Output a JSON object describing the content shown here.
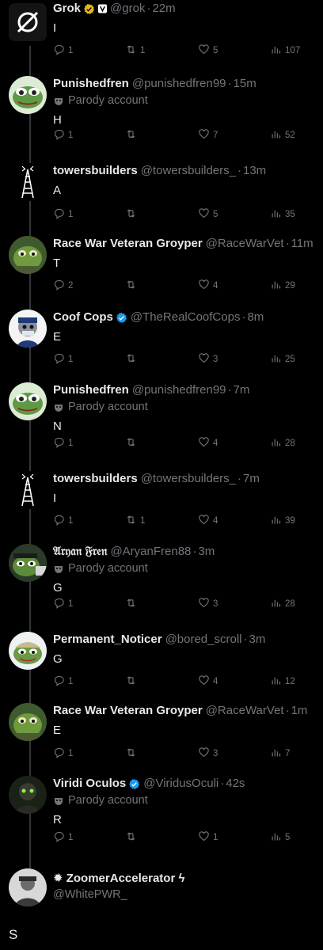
{
  "tweets": [
    {
      "name": "Grok",
      "handle": "@grok",
      "time": "22m",
      "text": "I",
      "replies": "1",
      "reposts": "1",
      "likes": "5",
      "views": "107",
      "verified": "gold",
      "affiliate": true
    },
    {
      "name": "Punishedfren",
      "handle": "@punishedfren99",
      "time": "15m",
      "parody": "Parody account",
      "text": "H",
      "replies": "1",
      "reposts": "",
      "likes": "7",
      "views": "52"
    },
    {
      "name": "towersbuilders",
      "handle": "@towersbuilders_",
      "time": "13m",
      "text": "A",
      "replies": "1",
      "reposts": "",
      "likes": "5",
      "views": "35"
    },
    {
      "name": "Race War Veteran Groyper",
      "handle": "@RaceWarVet",
      "time": "11m",
      "text": "T",
      "replies": "2",
      "reposts": "",
      "likes": "4",
      "views": "29"
    },
    {
      "name": "Coof Cops",
      "handle": "@TheRealCoofCops",
      "time": "8m",
      "text": "E",
      "replies": "1",
      "reposts": "",
      "likes": "3",
      "views": "25",
      "verified": "blue"
    },
    {
      "name": "Punishedfren",
      "handle": "@punishedfren99",
      "time": "7m",
      "parody": "Parody account",
      "text": "N",
      "replies": "1",
      "reposts": "",
      "likes": "4",
      "views": "28"
    },
    {
      "name": "towersbuilders",
      "handle": "@towersbuilders_",
      "time": "7m",
      "text": "I",
      "replies": "1",
      "reposts": "1",
      "likes": "4",
      "views": "39"
    },
    {
      "name": "𝔄𝔯𝔶𝔞𝔫 𝔉𝔯𝔢𝔫",
      "handle": "@AryanFren88",
      "time": "3m",
      "parody": "Parody account",
      "text": "G",
      "replies": "1",
      "reposts": "",
      "likes": "3",
      "views": "28"
    },
    {
      "name": "Permanent_Noticer",
      "handle": "@bored_scroll",
      "time": "3m",
      "text": "G",
      "replies": "1",
      "reposts": "",
      "likes": "4",
      "views": "12"
    },
    {
      "name": "Race War Veteran Groyper",
      "handle": "@RaceWarVet",
      "time": "1m",
      "text": "E",
      "replies": "1",
      "reposts": "",
      "likes": "3",
      "views": "7"
    },
    {
      "name": "Viridi Oculos",
      "handle": "@ViridusOculi",
      "time": "42s",
      "parody": "Parody account",
      "text": "R",
      "replies": "1",
      "reposts": "",
      "likes": "1",
      "views": "5",
      "verified": "blue"
    }
  ],
  "last": {
    "name": "✹ ZoomerAccelerator ϟ",
    "handle": "@WhitePWR_",
    "text": "S"
  },
  "separator": "·",
  "colors": {
    "background": "#000000",
    "text": "#e7e9ea",
    "muted": "#71767b",
    "verified_blue": "#1d9bf0",
    "verified_gold": "#e2b719"
  },
  "icons": [
    "reply-icon",
    "repost-icon",
    "like-icon",
    "views-icon",
    "verified-badge-icon",
    "parody-mask-icon"
  ]
}
